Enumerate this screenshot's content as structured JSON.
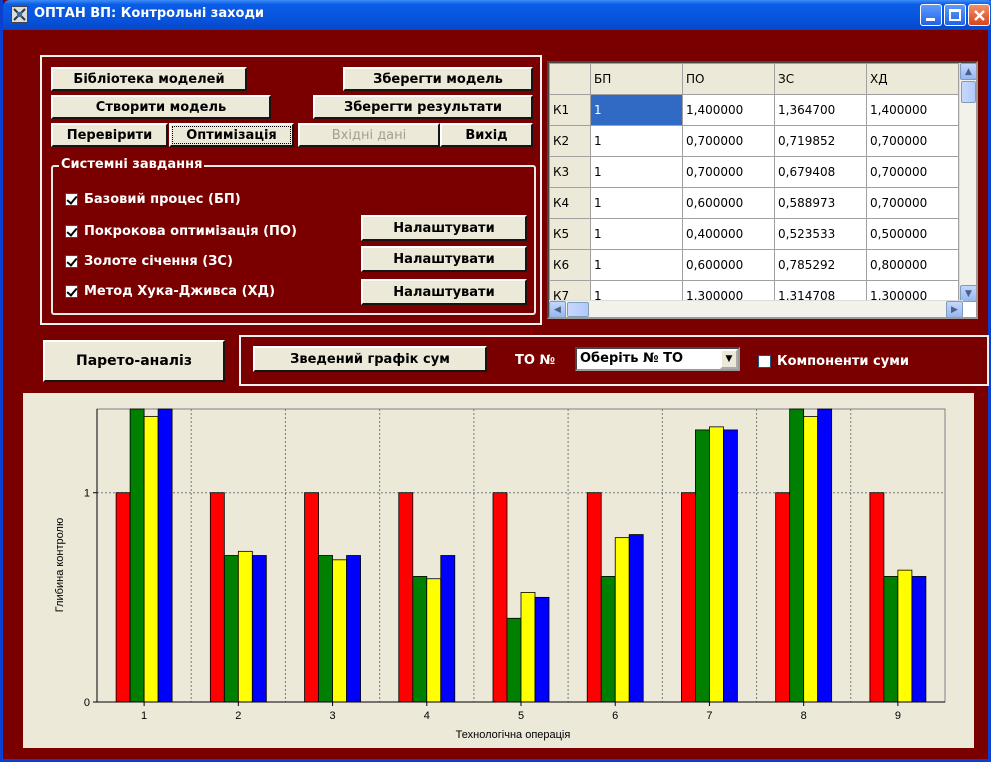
{
  "window": {
    "title": "ОПТАН ВП: Контрольні заходи"
  },
  "buttons": {
    "library": "Бібліотека моделей",
    "create": "Створити модель",
    "check": "Перевірити",
    "optimize": "Оптимізація",
    "save_model": "Зберегти модель",
    "save_results": "Зберегти результати",
    "input_data": "Вхідні дані",
    "exit": "Вихід",
    "configure": "Налаштувати",
    "pareto": "Парето-аналіз",
    "summary_chart": "Зведений графік сум"
  },
  "tasks": {
    "title": "Системні завдання",
    "items": [
      {
        "label": "Базовий процес (БП)",
        "checked": true
      },
      {
        "label": "Покрокова оптимізація (ПО)",
        "checked": true
      },
      {
        "label": "Золоте січення (ЗС)",
        "checked": true
      },
      {
        "label": "Метод Хука-Дживса (ХД)",
        "checked": true
      }
    ]
  },
  "grid": {
    "columns": [
      "",
      "БП",
      "ПО",
      "ЗС",
      "ХД"
    ],
    "rows": [
      [
        "К1",
        "1",
        "1,400000",
        "1,364700",
        "1,400000"
      ],
      [
        "К2",
        "1",
        "0,700000",
        "0,719852",
        "0,700000"
      ],
      [
        "К3",
        "1",
        "0,700000",
        "0,679408",
        "0,700000"
      ],
      [
        "К4",
        "1",
        "0,600000",
        "0,588973",
        "0,700000"
      ],
      [
        "К5",
        "1",
        "0,400000",
        "0,523533",
        "0,500000"
      ],
      [
        "К6",
        "1",
        "0,600000",
        "0,785292",
        "0,800000"
      ],
      [
        "К7",
        "1",
        "1,300000",
        "1,314708",
        "1,300000"
      ]
    ]
  },
  "to_selector": {
    "label": "ТО №",
    "value": "Оберіть № ТО"
  },
  "components_checkbox": {
    "label": "Компоненти суми",
    "checked": false
  },
  "chart_data": {
    "type": "bar",
    "categories": [
      "1",
      "2",
      "3",
      "4",
      "5",
      "6",
      "7",
      "8",
      "9"
    ],
    "series": [
      {
        "color": "#ff0000",
        "values": [
          1,
          1,
          1,
          1,
          1,
          1,
          1,
          1,
          1
        ]
      },
      {
        "color": "#008000",
        "values": [
          1.4,
          0.7,
          0.7,
          0.6,
          0.4,
          0.6,
          1.3,
          1.4,
          0.6
        ]
      },
      {
        "color": "#ffff00",
        "values": [
          1.3647,
          0.719852,
          0.679408,
          0.588973,
          0.523533,
          0.785292,
          1.314708,
          1.364,
          0.63
        ]
      },
      {
        "color": "#0000ff",
        "values": [
          1.4,
          0.7,
          0.7,
          0.7,
          0.5,
          0.8,
          1.3,
          1.4,
          0.6
        ]
      }
    ],
    "xlabel": "Технологічна операція",
    "ylabel": "Глибина контролю",
    "yticks": [
      "0",
      "1"
    ],
    "ylim": [
      0,
      1.4
    ],
    "grid": true
  }
}
